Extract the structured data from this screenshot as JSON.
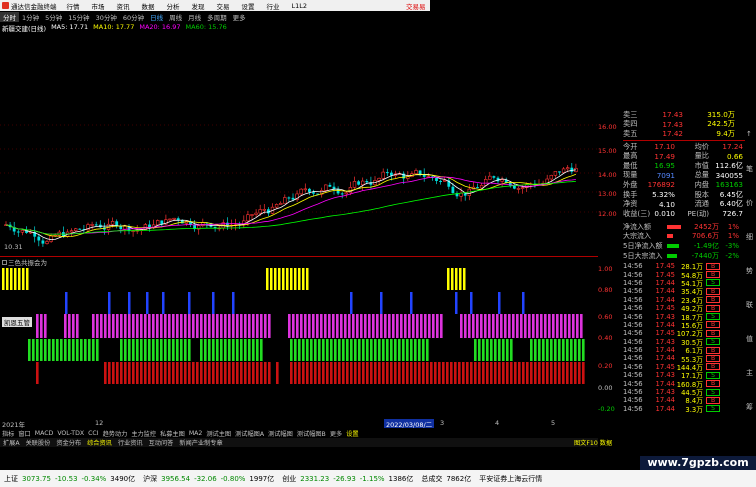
{
  "menubar": {
    "app_name": "通达信金融终端",
    "items": [
      "行情",
      "市场",
      "资讯",
      "数据",
      "分析",
      "发现",
      "交易",
      "设置",
      "行业",
      "L1L2"
    ],
    "right_label": "交易易"
  },
  "periodbar": {
    "items": [
      "分时",
      "1分钟",
      "5分钟",
      "15分钟",
      "30分钟",
      "60分钟",
      "日线",
      "周线",
      "月线",
      "多周期",
      "更多"
    ],
    "active": "日线"
  },
  "legend": {
    "title": "新疆交建(日线)",
    "ma": [
      {
        "label": "MA5: 17.71",
        "color": "#ffffff"
      },
      {
        "label": "MA10: 17.77",
        "color": "#ffff00"
      },
      {
        "label": "MA20: 16.97",
        "color": "#ff00ff"
      },
      {
        "label": "MA60: 15.76",
        "color": "#00ff00"
      }
    ]
  },
  "main_chart": {
    "low_label": "10.31",
    "price_axis": [
      "16.00",
      "15.00",
      "14.00",
      "13.00",
      "12.00"
    ]
  },
  "indicator": {
    "title": "三色共振会为",
    "sub_title": "凯恩五管",
    "axis": [
      "1.00",
      "0.80",
      "0.60",
      "0.40",
      "0.20",
      "0.00",
      "-0.20"
    ]
  },
  "date_axis": {
    "labels": [
      "2021年",
      "12",
      "2022/03/08/二",
      "3",
      "4",
      "5"
    ]
  },
  "tabs": [
    "指标",
    "窗口",
    "MACD",
    "VOL-TDX",
    "CCI",
    "趋势动力",
    "主力监控",
    "私募主图",
    "MA2",
    "测试主图",
    "测试幅图A",
    "测试幅图",
    "测试幅图B",
    "更多",
    "设置"
  ],
  "tabs2": [
    "扩展A",
    "关联股份",
    "资金分布",
    "综合资讯",
    "行业资讯",
    "互动问答",
    "新闻产业制专章"
  ],
  "quote": {
    "asks": [
      {
        "label": "卖三",
        "price": "17.43",
        "vol": "315.0万"
      },
      {
        "label": "卖四",
        "price": "17.43",
        "vol": "242.5万"
      },
      {
        "label": "卖五",
        "price": "17.42",
        "vol": "9.4万"
      }
    ],
    "rows": [
      [
        "今开",
        "17.10",
        "均价",
        "17.24"
      ],
      [
        "最高",
        "17.49",
        "量比",
        "0.66"
      ],
      [
        "最低",
        "16.95",
        "市值",
        "112.6亿"
      ],
      [
        "现量",
        "7091",
        "总量",
        "340055"
      ],
      [
        "外盘",
        "176892",
        "内盘",
        "163163"
      ],
      [
        "换手",
        "5.32%",
        "股本",
        "6.45亿"
      ],
      [
        "净资",
        "4.10",
        "流通",
        "6.40亿"
      ],
      [
        "收益(三)",
        "0.010",
        "PE(动)",
        "726.7"
      ]
    ]
  },
  "flow": [
    {
      "label": "净流入额",
      "value": "2452万",
      "pct": "1%"
    },
    {
      "label": "大宗流入",
      "value": "706.6万",
      "pct": "1%"
    },
    {
      "label": "5日净流入额",
      "value": "-1.49亿",
      "pct": "-3%"
    },
    {
      "label": "5日大宗流入",
      "value": "-7440万",
      "pct": "-2%"
    }
  ],
  "ticks": [
    [
      "14:56",
      "17.45",
      "28.1万",
      "B"
    ],
    [
      "14:56",
      "17.45",
      "54.8万",
      "B"
    ],
    [
      "14:56",
      "17.44",
      "54.1万",
      "S"
    ],
    [
      "14:56",
      "17.44",
      "35.4万",
      "B"
    ],
    [
      "14:56",
      "17.44",
      "23.4万",
      "B"
    ],
    [
      "14:56",
      "17.45",
      "49.2万",
      "B"
    ],
    [
      "14:56",
      "17.43",
      "18.7万",
      "S"
    ],
    [
      "14:56",
      "17.44",
      "15.6万",
      "B"
    ],
    [
      "14:56",
      "17.45",
      "107.2万",
      "B"
    ],
    [
      "14:56",
      "17.43",
      "30.5万",
      "S"
    ],
    [
      "14:56",
      "17.44",
      "6.1万",
      "B"
    ],
    [
      "14:56",
      "17.44",
      "55.3万",
      "B"
    ],
    [
      "14:56",
      "17.45",
      "144.4万",
      "B"
    ],
    [
      "14:56",
      "17.43",
      "17.1万",
      "S"
    ],
    [
      "14:56",
      "17.44",
      "160.8万",
      "B"
    ],
    [
      "14:56",
      "17.43",
      "44.5万",
      "S"
    ],
    [
      "14:56",
      "17.44",
      "8.4万",
      "B"
    ],
    [
      "14:56",
      "17.44",
      "3.3万",
      "S"
    ]
  ],
  "right_strip": [
    "↑",
    "笔",
    "价",
    "细",
    "势",
    "联",
    "值",
    "主",
    "筹"
  ],
  "watermark": "www.7gpzb.com",
  "status_line": {
    "left": "图文F10 数据",
    "right": "平安证券上海上海云行情"
  },
  "bottom": {
    "indices": [
      {
        "name": "上证",
        "value": "3073.75",
        "chg": "-10.53",
        "pct": "-0.34%",
        "amt": "3490亿"
      },
      {
        "name": "沪深",
        "value": "3956.54",
        "chg": "-32.06",
        "pct": "-0.80%",
        "amt": "1997亿"
      },
      {
        "name": "创业",
        "value": "2331.23",
        "chg": "-26.93",
        "pct": "-1.15%",
        "amt": "1386亿"
      }
    ],
    "total_label": "总成交",
    "total_value": "7862亿",
    "broker": "平安证券上海云行情"
  },
  "colors": {
    "up": "#ff3333",
    "down": "#00cc00",
    "ma5": "#ffffff",
    "ma10": "#ffff00",
    "ma20": "#ff00ff",
    "ma60": "#00ff00",
    "ind_yellow": "#ffff00",
    "ind_blue": "#2244ff",
    "ind_magenta": "#dd33dd",
    "ind_green": "#22dd22",
    "ind_red": "#cc1111"
  }
}
